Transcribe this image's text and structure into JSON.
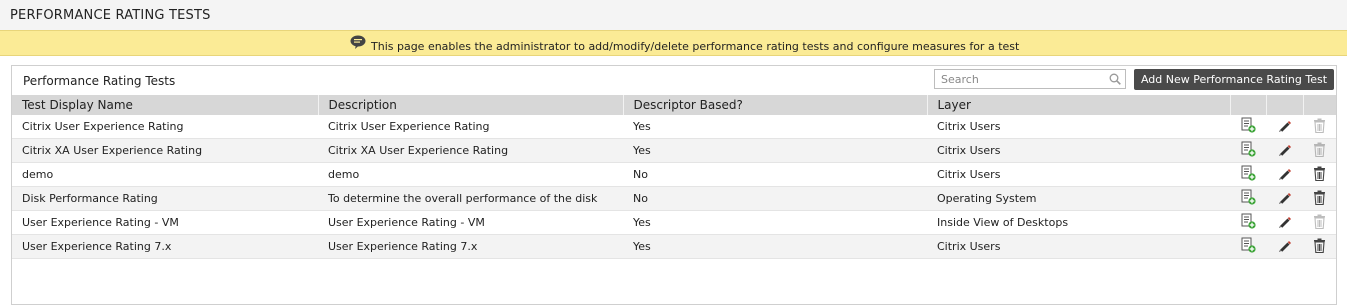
{
  "page": {
    "title": "PERFORMANCE RATING TESTS",
    "info_message": "This page enables the administrator to add/modify/delete performance rating tests and configure measures for a test"
  },
  "panel": {
    "title": "Performance Rating Tests",
    "search_placeholder": "Search",
    "add_button_label": "Add New Performance Rating Test"
  },
  "table": {
    "columns": [
      "Test Display Name",
      "Description",
      "Descriptor Based?",
      "Layer"
    ],
    "rows": [
      {
        "name": "Citrix User Experience Rating",
        "description": "Citrix User Experience Rating",
        "descriptor_based": "Yes",
        "layer": "Citrix Users",
        "delete_enabled": false
      },
      {
        "name": "Citrix XA User Experience Rating",
        "description": "Citrix XA User Experience Rating",
        "descriptor_based": "Yes",
        "layer": "Citrix Users",
        "delete_enabled": false
      },
      {
        "name": "demo",
        "description": "demo",
        "descriptor_based": "No",
        "layer": "Citrix Users",
        "delete_enabled": true
      },
      {
        "name": "Disk Performance Rating",
        "description": "To determine the overall performance of the disk",
        "descriptor_based": "No",
        "layer": "Operating System",
        "delete_enabled": true
      },
      {
        "name": "User Experience Rating - VM",
        "description": "User Experience Rating - VM",
        "descriptor_based": "Yes",
        "layer": "Inside View of Desktops",
        "delete_enabled": false
      },
      {
        "name": "User Experience Rating 7.x",
        "description": "User Experience Rating 7.x",
        "descriptor_based": "Yes",
        "layer": "Citrix Users",
        "delete_enabled": true
      }
    ],
    "row_actions": [
      "configure-measures-icon",
      "edit-pencil-icon",
      "delete-trash-icon"
    ]
  },
  "colors": {
    "info_bar": "#fbeb96",
    "header_row": "#d7d7d7",
    "button": "#4a4a4a",
    "edit_icon": "#c0392b",
    "add_badge": "#3aa335"
  }
}
